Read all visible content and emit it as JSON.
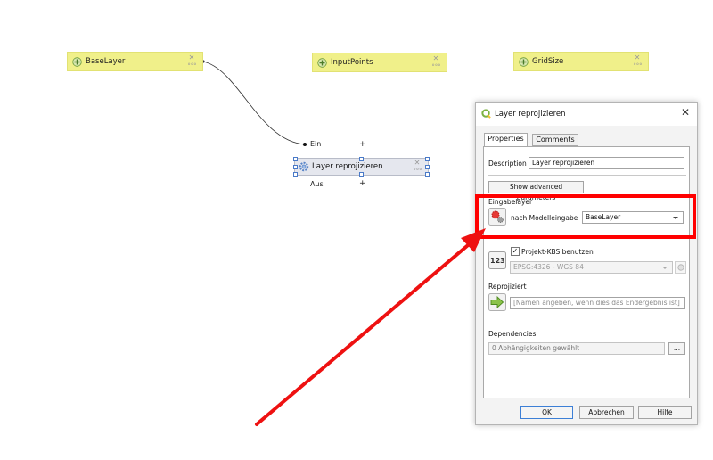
{
  "canvas": {
    "input_nodes": [
      {
        "name": "base-layer-node",
        "label": "BaseLayer"
      },
      {
        "name": "input-points-node",
        "label": "InputPoints"
      },
      {
        "name": "grid-size-node",
        "label": "GridSize"
      }
    ],
    "algorithm_node": {
      "label": "Layer reprojizieren",
      "input_port": "Ein",
      "output_port": "Aus"
    },
    "node_close_glyph": "✕",
    "port_add_glyph": "+"
  },
  "dialog": {
    "title": "Layer reprojizieren",
    "close_glyph": "✕",
    "tabs": [
      {
        "label": "Properties",
        "active": true
      },
      {
        "label": "Comments",
        "active": false
      }
    ],
    "description_label": "Description",
    "description_value": "Layer reprojizieren",
    "advanced_button": "Show advanced parameters",
    "input_layer": {
      "label": "Eingabelayer",
      "source": "nach Modelleingabe",
      "value": "BaseLayer"
    },
    "crs": {
      "checkbox_label": "Projekt-KBS benutzen",
      "checked": true,
      "check_glyph": "✓",
      "number_icon_text": "123",
      "value": "EPSG:4326 - WGS 84"
    },
    "output": {
      "label": "Reprojiziert",
      "placeholder": "[Namen angeben, wenn dies das Endergebnis ist]"
    },
    "dependencies": {
      "label": "Dependencies",
      "value": "0 Abhängigkeiten gewählt",
      "browse_label": "..."
    },
    "buttons": {
      "ok": "OK",
      "cancel": "Abbrechen",
      "help": "Hilfe"
    }
  },
  "annotation": {
    "highlight_color": "#ff0000",
    "arrow_color": "#ee1111"
  },
  "colors": {
    "input_node": "#f0f08a",
    "algorithm_node": "#e5e7ee",
    "selection": "#4a7ac8"
  }
}
